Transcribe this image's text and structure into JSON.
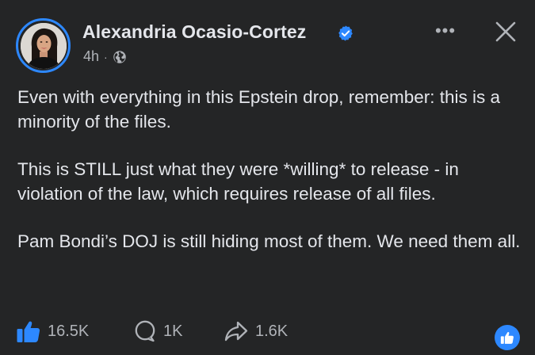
{
  "author": {
    "name": "Alexandria Ocasio-Cortez",
    "verified_icon": "verified-badge-icon",
    "time": "4h",
    "separator": "·",
    "audience_icon": "globe-icon"
  },
  "post": {
    "paragraphs": [
      "Even with everything in this Epstein drop, remember: this is a minority of the files.",
      "This is STILL just what they were *willing* to release - in violation of the law, which requires release of all files.",
      "Pam Bondi’s DOJ is still hiding most of them. We need them all."
    ]
  },
  "actions": {
    "likes": "16.5K",
    "comments": "1K",
    "shares": "1.6K"
  },
  "menu": {
    "more_label": "•••"
  },
  "colors": {
    "background": "#242526",
    "text_primary": "#e4e6eb",
    "text_secondary": "#b0b3b8",
    "accent": "#2d88ff"
  }
}
